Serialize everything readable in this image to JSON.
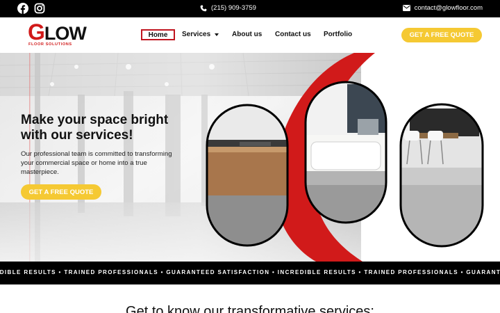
{
  "topbar": {
    "phone": "(215) 909-3759",
    "email": "contact@glowfloor.com",
    "icons": [
      "facebook-icon",
      "instagram-icon",
      "phone-icon",
      "envelope-icon"
    ]
  },
  "header": {
    "logo_g": "G",
    "logo_rest": "LOW",
    "logo_tagline": "FLOOR SOLUTIONS",
    "nav": {
      "home": "Home",
      "services": "Services",
      "about": "About us",
      "contact": "Contact us",
      "portfolio": "Portfolio"
    },
    "cta": "GET A FREE QUOTE"
  },
  "hero": {
    "title": "Make your space bright with our services!",
    "text": "Our professional team is committed to transforming your commercial space or home into a true masterpiece.",
    "cta": "GET A FREE QUOTE"
  },
  "ticker": {
    "text": "EDIBLE RESULTS • TRAINED PROFESSIONALS • GUARANTEED SATISFACTION • INCREDIBLE RESULTS • TRAINED PROFESSIONALS • GUARANTEED SATISFACTION"
  },
  "section": {
    "title": "Get to know our transformative services:"
  },
  "colors": {
    "accent_yellow": "#f5c933",
    "brand_red": "#d11a1a",
    "topbar_black": "#000000"
  }
}
